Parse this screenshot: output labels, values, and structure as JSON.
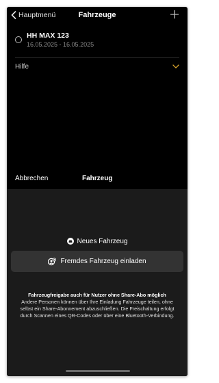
{
  "header": {
    "back_label": "Hauptmenü",
    "title": "Fahrzeuge",
    "add_icon": "plus-icon"
  },
  "vehicles": [
    {
      "name": "HH MAX 123",
      "dates": "16.05.2025 - 16.05.2025",
      "selected": false
    }
  ],
  "help": {
    "label": "Hilfe",
    "chevron_color": "#d4a02a"
  },
  "sheet": {
    "cancel_label": "Abbrechen",
    "title": "Fahrzeug",
    "new_vehicle_label": "Neues Fahrzeug",
    "invite_label": "Fremdes Fahrzeug einladen",
    "info_title": "Fahrzeugfreigabe auch für Nutzer ohne Share-Abo möglich",
    "info_body": "Andere Personen können über Ihre Einladung Fahrzeuge teilen, ohne selbst ein Share-Abonnement abzuschließen. Die Freischaltung erfolgt durch Scannen eines QR-Codes oder über eine Bluetooth-Verbindung."
  },
  "colors": {
    "background": "#000000",
    "sheet_background": "#1b1b1b",
    "button_background": "#333333",
    "accent": "#d4a02a"
  }
}
